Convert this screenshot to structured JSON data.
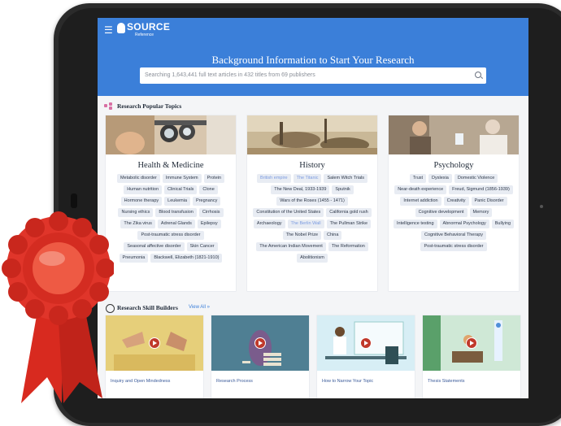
{
  "app": {
    "brand": "SOURCE",
    "brand_sub": "Reference",
    "accent_color": "#3b7fd9"
  },
  "hero": {
    "title": "Background Information to Start Your Research",
    "search_placeholder": "Searching 1,643,441 full text articles in 432 titles from 69 publishers"
  },
  "popular": {
    "heading": "Research Popular Topics",
    "cards": [
      {
        "title": "Health & Medicine",
        "tags": [
          "Metabolic disorder",
          "Immune System",
          "Protein",
          "Human nutrition",
          "Clinical Trials",
          "Clone",
          "Hormone therapy",
          "Leukemia",
          "Pregnancy",
          "Nursing ethics",
          "Blood transfusion",
          "Cirrhosis",
          "The Zika virus",
          "Adrenal Glands",
          "Epilepsy",
          "Post-traumatic stress disorder",
          "Seasonal affective disorder",
          "Skin Cancer",
          "Pneumonia",
          "Blackwell, Elizabeth (1821-1910)"
        ]
      },
      {
        "title": "History",
        "tags": [
          "British empire",
          "The Titanic",
          "Salem Witch Trials",
          "The New Deal, 1933-1939",
          "Sputnik",
          "Wars of the Roses (1455 - 1471)",
          "Constitution of the United States",
          "California gold rush",
          "Archaeology",
          "The Berlin Wall",
          "The Pullman Strike",
          "The Nobel Prize",
          "China",
          "The American Indian Movement",
          "The Reformation",
          "Abolitionism"
        ],
        "highlighted": [
          "British empire",
          "The Titanic",
          "The Berlin Wall"
        ]
      },
      {
        "title": "Psychology",
        "tags": [
          "Trust",
          "Dyslexia",
          "Domestic Violence",
          "Near-death experience",
          "Freud, Sigmund (1856-1939)",
          "Internet addiction",
          "Creativity",
          "Panic Disorder",
          "Cognitive development",
          "Memory",
          "Intelligence testing",
          "Abnormal Psychology",
          "Bullying",
          "Cognitive Behavioral Therapy",
          "Post-traumatic stress disorder"
        ]
      }
    ]
  },
  "skills": {
    "heading": "Research Skill Builders",
    "view_all": "View All »",
    "videos": [
      {
        "label": "Inquiry and Open Mindedness"
      },
      {
        "label": "Research Process"
      },
      {
        "label": "How to Narrow Your Topic"
      },
      {
        "label": "Thesis Statements"
      }
    ]
  }
}
